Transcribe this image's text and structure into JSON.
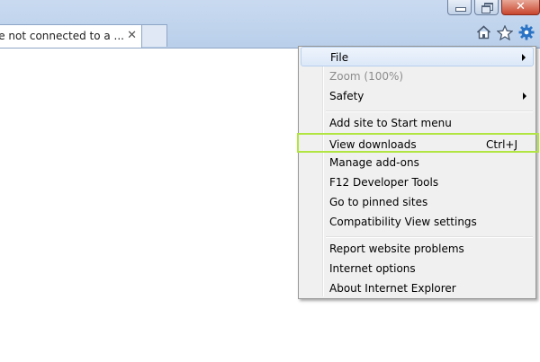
{
  "window": {
    "controls": {
      "minimize_icon": "minimize-icon",
      "restore_icon": "restore-icon",
      "close_icon": "close-icon",
      "close_glyph": "✕"
    }
  },
  "tab": {
    "title": "u're not connected to a ...",
    "close_glyph": "✕"
  },
  "toolbar": {
    "home_icon": "home-icon",
    "favorites_icon": "star-icon",
    "tools_icon": "gear-icon"
  },
  "menu": {
    "items": [
      {
        "label": "File",
        "submenu": true
      },
      {
        "label": "Zoom (100%)",
        "disabled": true
      },
      {
        "label": "Safety",
        "submenu": true
      },
      {
        "label": "Add site to Start menu"
      },
      {
        "label": "View downloads",
        "shortcut": "Ctrl+J"
      },
      {
        "label": "Manage add-ons"
      },
      {
        "label": "F12 Developer Tools"
      },
      {
        "label": "Go to pinned sites"
      },
      {
        "label": "Compatibility View settings"
      },
      {
        "label": "Report website problems"
      },
      {
        "label": "Internet options"
      },
      {
        "label": "About Internet Explorer"
      }
    ]
  },
  "colors": {
    "highlight_outline": "#b1e542",
    "titlebar": "#c9daf0",
    "icon_blue": "#2a73c5"
  }
}
